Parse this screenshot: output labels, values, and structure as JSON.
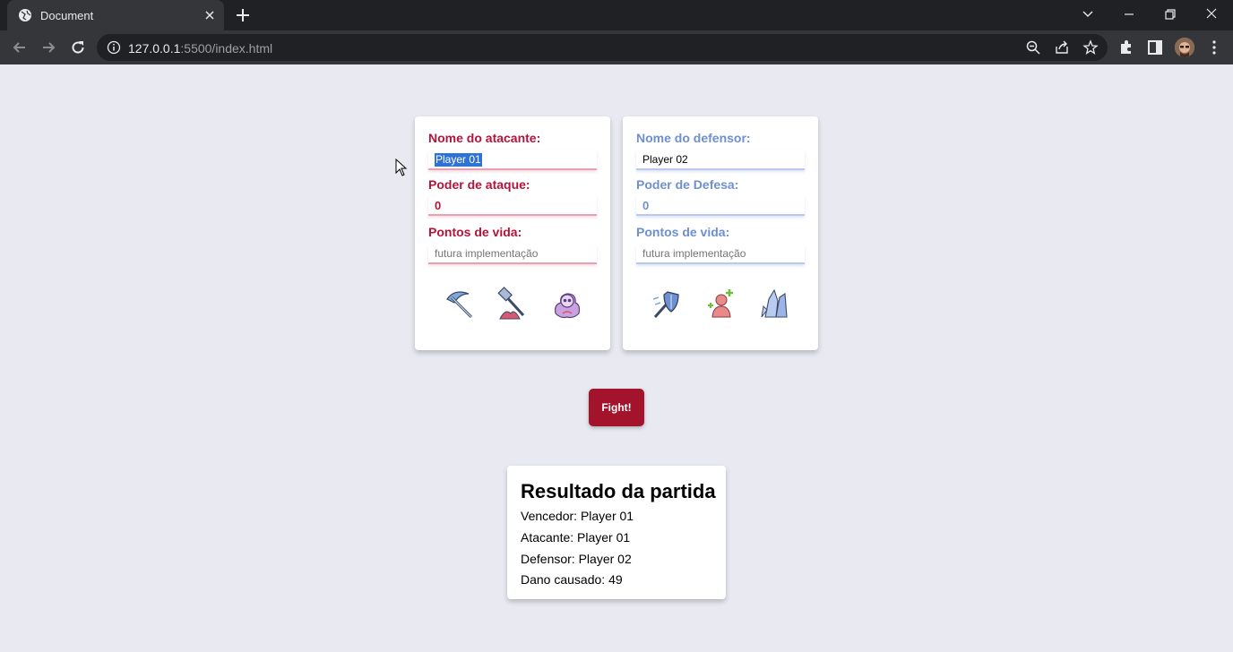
{
  "browser": {
    "tab_title": "Document",
    "url_host": "127.0.0.1",
    "url_rest": ":5500/index.html"
  },
  "attacker": {
    "name_label": "Nome do atacante:",
    "name_value": "Player 01",
    "power_label": "Poder de ataque:",
    "power_value": "0",
    "hp_label": "Pontos de vida:",
    "hp_placeholder": "futura implementação",
    "icons": [
      "scythe-icon",
      "hammer-icon",
      "skull-spell-icon"
    ]
  },
  "defender": {
    "name_label": "Nome do defensor:",
    "name_value": "Player 02",
    "power_label": "Poder de Defesa:",
    "power_value": "0",
    "hp_label": "Pontos de vida:",
    "hp_placeholder": "futura implementação",
    "icons": [
      "shield-sword-icon",
      "heal-person-icon",
      "crystal-icon"
    ]
  },
  "fight_button": "Fight!",
  "result": {
    "title": "Resultado da partida",
    "winner": "Vencedor: Player 01",
    "attacker": "Atacante: Player 01",
    "defender": "Defensor: Player 02",
    "damage": "Dano causado: 49"
  },
  "colors": {
    "attacker_accent": "#b3143a",
    "defender_accent": "#6e8fd0",
    "fight_button": "#a3142c",
    "page_background": "#e9e9f1"
  }
}
